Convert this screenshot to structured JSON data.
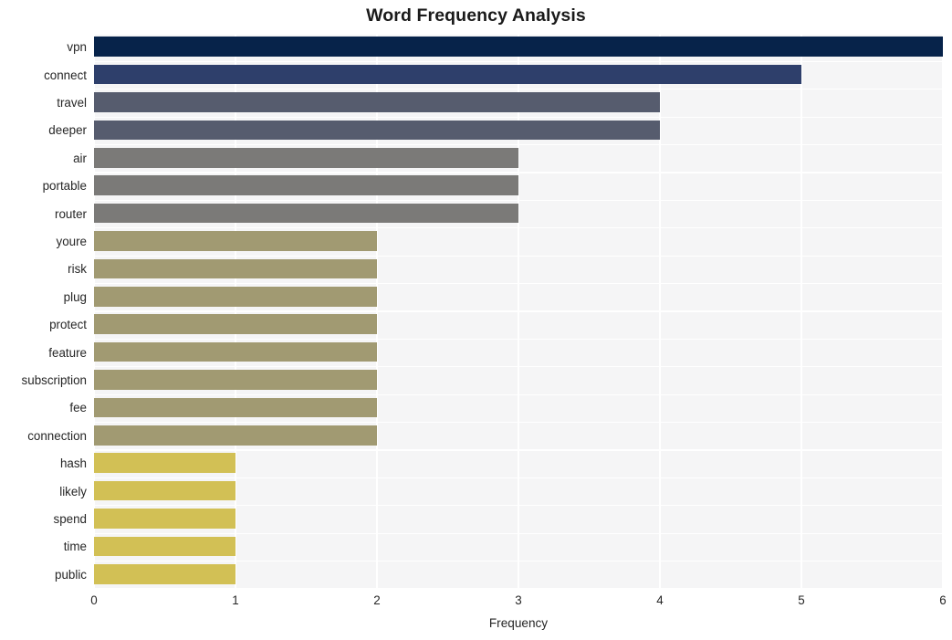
{
  "chart_data": {
    "type": "bar",
    "orientation": "horizontal",
    "title": "Word Frequency Analysis",
    "xlabel": "Frequency",
    "ylabel": "",
    "xlim": [
      0,
      6
    ],
    "xticks": [
      0,
      1,
      2,
      3,
      4,
      5,
      6
    ],
    "xtick_labels": [
      "0",
      "1",
      "2",
      "3",
      "4",
      "5",
      "6"
    ],
    "grid": true,
    "legend": "none",
    "categories": [
      "vpn",
      "connect",
      "travel",
      "deeper",
      "air",
      "portable",
      "router",
      "youre",
      "risk",
      "plug",
      "protect",
      "feature",
      "subscription",
      "fee",
      "connection",
      "hash",
      "likely",
      "spend",
      "time",
      "public"
    ],
    "values": [
      6,
      5,
      4,
      4,
      3,
      3,
      3,
      2,
      2,
      2,
      2,
      2,
      2,
      2,
      2,
      1,
      1,
      1,
      1,
      1
    ],
    "bar_colors": [
      "#07234a",
      "#2e3f6b",
      "#565c6e",
      "#565c6e",
      "#7b7a78",
      "#7b7a78",
      "#7b7a78",
      "#a19a72",
      "#a19a72",
      "#a19a72",
      "#a19a72",
      "#a19a72",
      "#a19a72",
      "#a19a72",
      "#a19a72",
      "#d2c055",
      "#d2c055",
      "#d2c055",
      "#d2c055",
      "#d2c055"
    ],
    "plot_background": "#f5f5f6",
    "gridline_color": "#ffffff",
    "figure_background": "#ffffff"
  }
}
